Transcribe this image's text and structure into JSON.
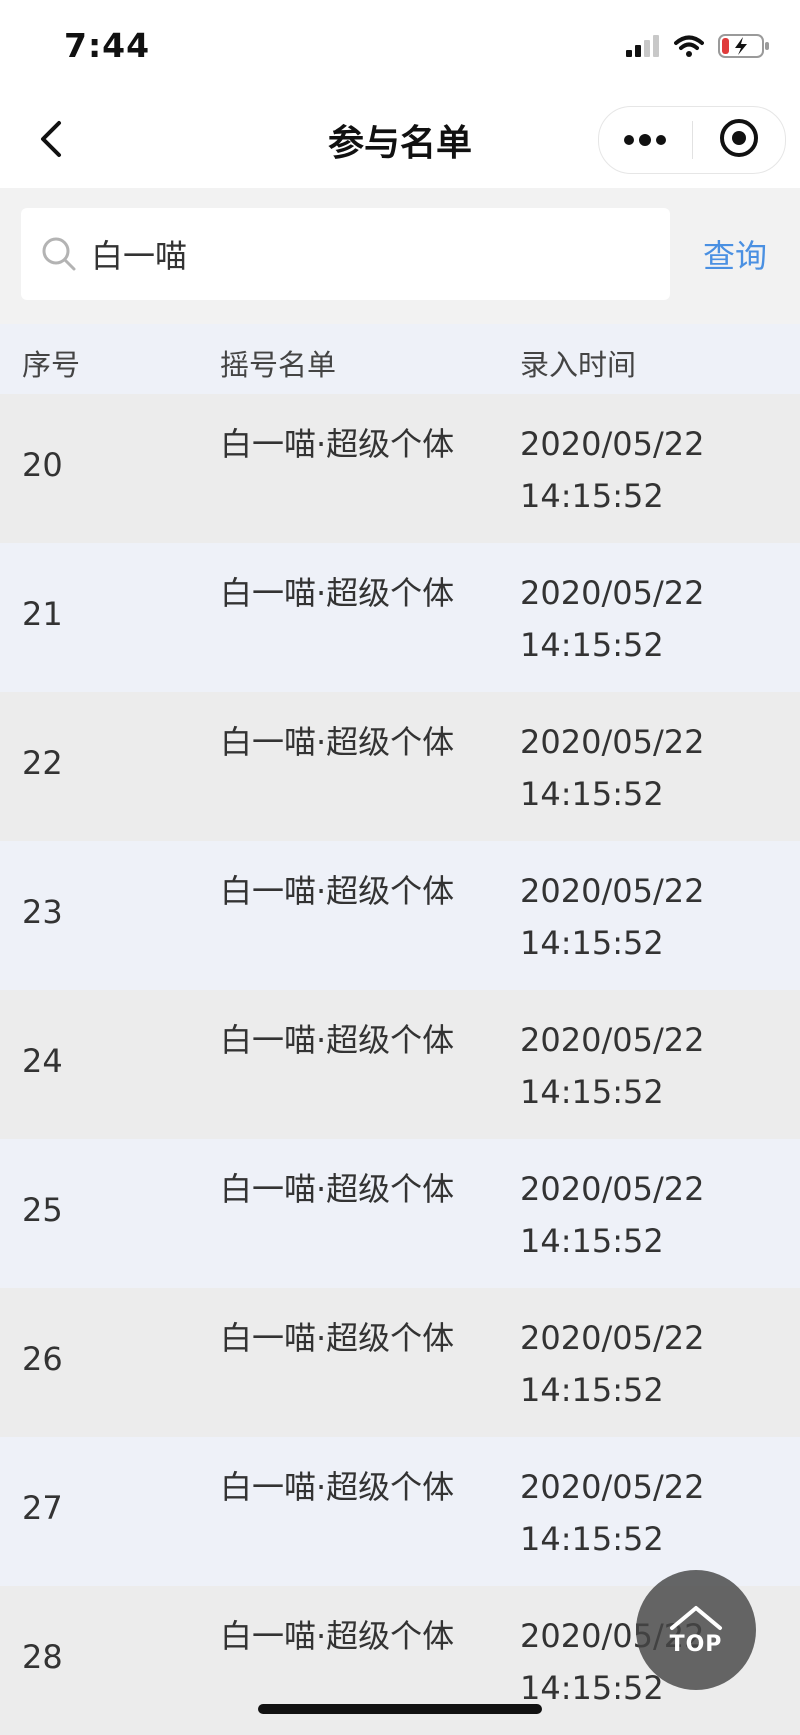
{
  "status_bar": {
    "time": "7:44"
  },
  "nav": {
    "title": "参与名单"
  },
  "search": {
    "value": "白一喵",
    "button_label": "查询"
  },
  "table": {
    "headers": [
      "序号",
      "摇号名单",
      "录入时间"
    ],
    "rows": [
      {
        "index": "20",
        "name": "白一喵·超级个体",
        "date": "2020/05/22",
        "time": "14:15:52"
      },
      {
        "index": "21",
        "name": "白一喵·超级个体",
        "date": "2020/05/22",
        "time": "14:15:52"
      },
      {
        "index": "22",
        "name": "白一喵·超级个体",
        "date": "2020/05/22",
        "time": "14:15:52"
      },
      {
        "index": "23",
        "name": "白一喵·超级个体",
        "date": "2020/05/22",
        "time": "14:15:52"
      },
      {
        "index": "24",
        "name": "白一喵·超级个体",
        "date": "2020/05/22",
        "time": "14:15:52"
      },
      {
        "index": "25",
        "name": "白一喵·超级个体",
        "date": "2020/05/22",
        "time": "14:15:52"
      },
      {
        "index": "26",
        "name": "白一喵·超级个体",
        "date": "2020/05/22",
        "time": "14:15:52"
      },
      {
        "index": "27",
        "name": "白一喵·超级个体",
        "date": "2020/05/22",
        "time": "14:15:52"
      },
      {
        "index": "28",
        "name": "白一喵·超级个体",
        "date": "2020/05/22",
        "time": "14:15:52"
      }
    ]
  },
  "top_button": {
    "label": "TOP"
  },
  "icons": {
    "status": [
      "signal-icon",
      "wifi-icon",
      "battery-icon"
    ],
    "nav": [
      "back-arrow-icon",
      "more-dots-icon",
      "target-close-icon"
    ],
    "search": "search-icon",
    "top": "chevron-up-icon"
  },
  "colors": {
    "accent": "#4a90e2",
    "header_bg": "#eef1f8",
    "row_odd_bg": "#ececec",
    "row_even_bg": "#eef1f8",
    "battery_low": "#e03b3b"
  }
}
